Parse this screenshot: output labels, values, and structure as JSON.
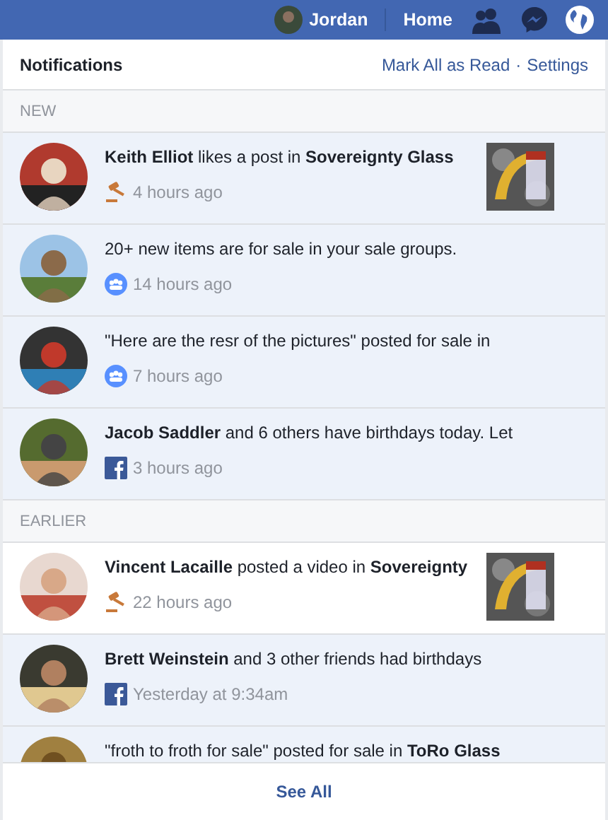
{
  "topbar": {
    "user": "Jordan",
    "home": "Home"
  },
  "panel": {
    "title": "Notifications",
    "mark_all": "Mark All as Read",
    "separator": "·",
    "settings": "Settings",
    "footer": "See All"
  },
  "sections": [
    {
      "label": "NEW",
      "items": [
        {
          "kind": "sale",
          "text": "**Keith Elliot** likes a post in **Sovereignty Glass**",
          "time": "4 hours ago",
          "unread": true,
          "thumbnail": true
        },
        {
          "kind": "group",
          "text": "20+ new items are for sale in your sale groups.",
          "time": "14 hours ago",
          "unread": true,
          "thumbnail": false
        },
        {
          "kind": "group",
          "text": "\"Here are the resr of the pictures\" posted for sale in",
          "time": "7 hours ago",
          "unread": true,
          "thumbnail": false
        },
        {
          "kind": "birthday",
          "text": "**Jacob Saddler** and 6 others have birthdays today. Let",
          "time": "3 hours ago",
          "unread": true,
          "thumbnail": false
        }
      ]
    },
    {
      "label": "EARLIER",
      "items": [
        {
          "kind": "sale",
          "text": "**Vincent Lacaille** posted a video in **Sovereignty**",
          "time": "22 hours ago",
          "unread": false,
          "thumbnail": true
        },
        {
          "kind": "birthday",
          "text": "**Brett Weinstein** and 3 other friends had birthdays",
          "time": "Yesterday at 9:34am",
          "unread": true,
          "thumbnail": false
        },
        {
          "text": "\"froth to froth for sale\" posted for sale in **ToRo Glass**",
          "unread": true
        }
      ]
    }
  ]
}
